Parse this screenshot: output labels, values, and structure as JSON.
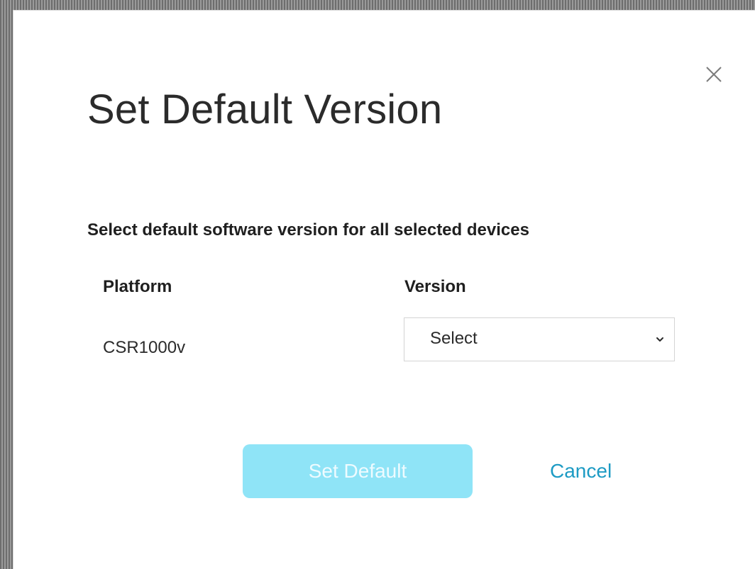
{
  "dialog": {
    "title": "Set Default Version",
    "subtitle": "Select default software version for all selected devices",
    "close_icon": "close-icon"
  },
  "table": {
    "headers": {
      "platform": "Platform",
      "version": "Version"
    },
    "rows": [
      {
        "platform": "CSR1000v",
        "version_select": {
          "selected": "Select",
          "icon": "chevron-down-icon"
        }
      }
    ]
  },
  "actions": {
    "primary_label": "Set Default",
    "secondary_label": "Cancel"
  },
  "colors": {
    "primary_button": "#8fe4f7",
    "primary_button_text": "#eefbff",
    "link": "#1d9bc4",
    "title_text": "#2b2b2b",
    "dialog_background": "#ffffff",
    "border": "#d4d4d4"
  }
}
